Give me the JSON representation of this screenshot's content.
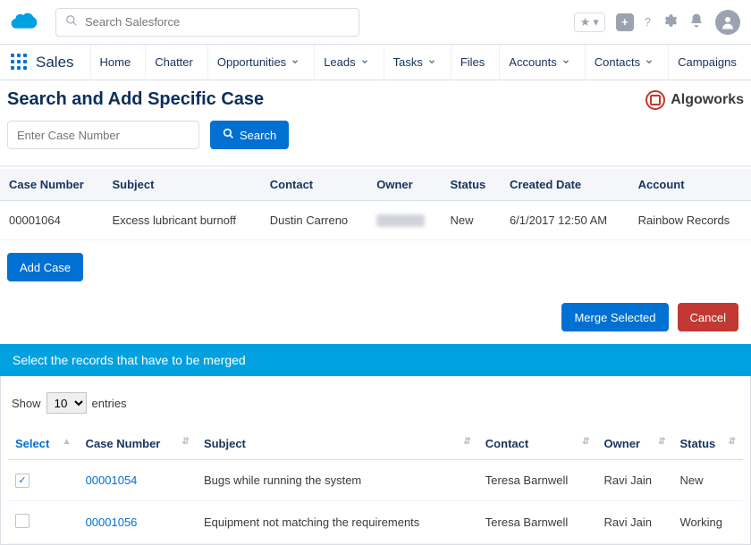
{
  "header": {
    "search_placeholder": "Search Salesforce"
  },
  "nav": {
    "app_name": "Sales",
    "items": [
      "Home",
      "Chatter",
      "Opportunities",
      "Leads",
      "Tasks",
      "Files",
      "Accounts",
      "Contacts",
      "Campaigns"
    ],
    "has_caret": [
      false,
      false,
      true,
      true,
      true,
      false,
      true,
      true,
      false
    ]
  },
  "page": {
    "title": "Search and Add Specific Case",
    "brand": "Algoworks",
    "case_placeholder": "Enter Case Number",
    "search_btn": "Search",
    "add_case_btn": "Add Case",
    "merge_btn": "Merge Selected",
    "cancel_btn": "Cancel",
    "banner": "Select the records that have to be merged",
    "show_label_prefix": "Show",
    "show_label_suffix": "entries",
    "page_size": "10"
  },
  "table1": {
    "cols": [
      "Case Number",
      "Subject",
      "Contact",
      "Owner",
      "Status",
      "Created Date",
      "Account"
    ],
    "row": {
      "case": "00001064",
      "subject": "Excess lubricant burnoff",
      "contact": "Dustin Carreno",
      "owner": "",
      "status": "New",
      "created": "6/1/2017 12:50 AM",
      "account": "Rainbow Records"
    }
  },
  "table2": {
    "cols": [
      "Select",
      "Case Number",
      "Subject",
      "Contact",
      "Owner",
      "Status"
    ],
    "rows": [
      {
        "checked": true,
        "case": "00001054",
        "subject": "Bugs while running the system",
        "contact": "Teresa Barnwell",
        "owner": "Ravi Jain",
        "status": "New"
      },
      {
        "checked": false,
        "case": "00001056",
        "subject": "Equipment not matching the requirements",
        "contact": "Teresa Barnwell",
        "owner": "Ravi Jain",
        "status": "Working"
      }
    ]
  }
}
